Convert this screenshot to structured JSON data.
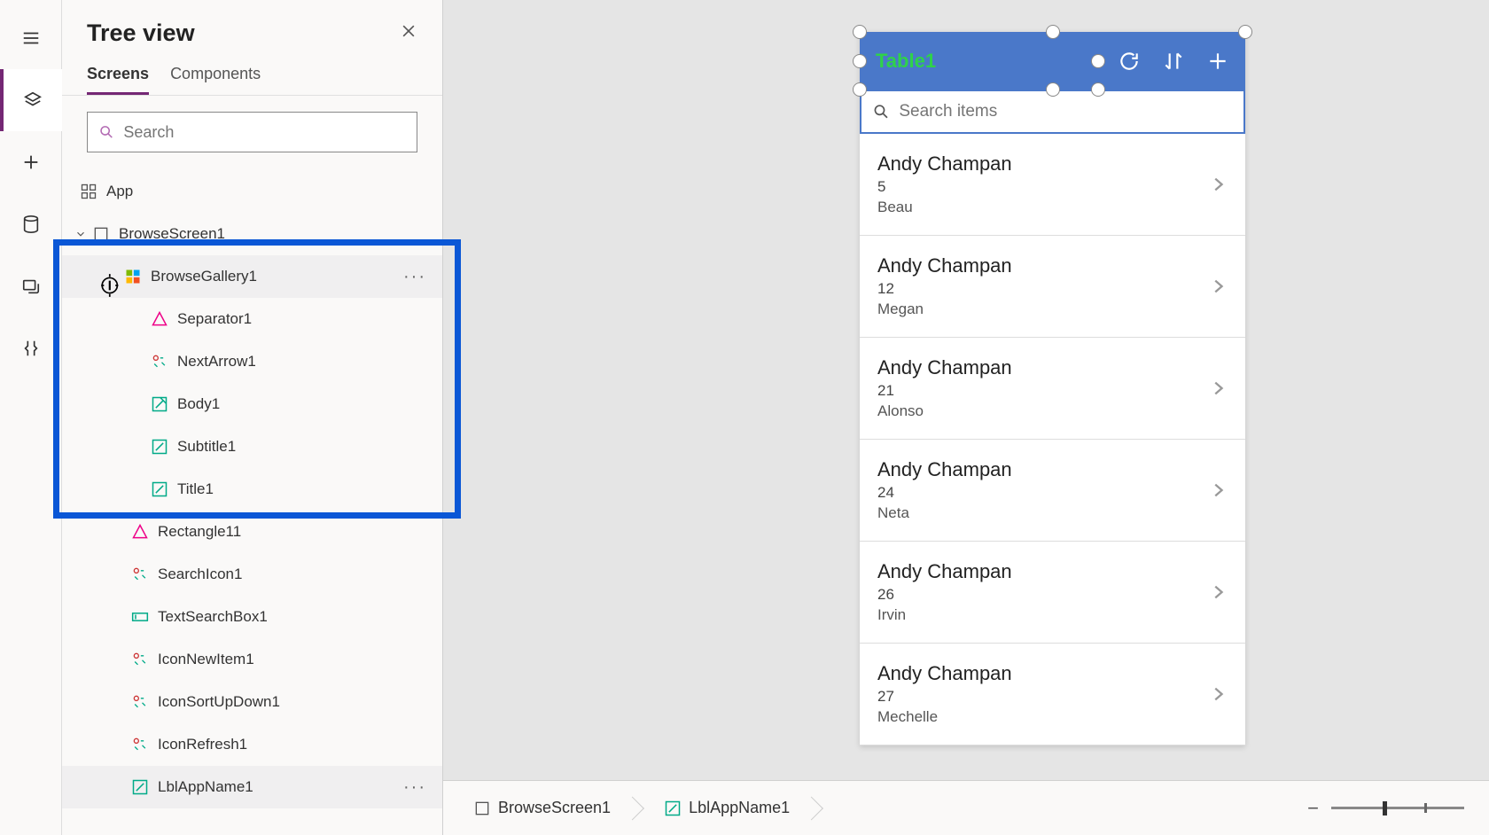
{
  "panel": {
    "title": "Tree view",
    "tabs": {
      "screens": "Screens",
      "components": "Components"
    },
    "search_placeholder": "Search"
  },
  "tree": {
    "app": "App",
    "browseScreen": "BrowseScreen1",
    "browseGallery": "BrowseGallery1",
    "children": {
      "separator": "Separator1",
      "nextArrow": "NextArrow1",
      "body": "Body1",
      "subtitle": "Subtitle1",
      "title": "Title1"
    },
    "rectangle": "Rectangle11",
    "searchIcon": "SearchIcon1",
    "textSearchBox": "TextSearchBox1",
    "iconNewItem": "IconNewItem1",
    "iconSortUpDown": "IconSortUpDown1",
    "iconRefresh": "IconRefresh1",
    "lblAppName": "LblAppName1"
  },
  "canvas": {
    "header_label": "Table1",
    "search_placeholder": "Search items",
    "rows": [
      {
        "title": "Andy Champan",
        "sub": "5",
        "body": "Beau"
      },
      {
        "title": "Andy Champan",
        "sub": "12",
        "body": "Megan"
      },
      {
        "title": "Andy Champan",
        "sub": "21",
        "body": "Alonso"
      },
      {
        "title": "Andy Champan",
        "sub": "24",
        "body": "Neta"
      },
      {
        "title": "Andy Champan",
        "sub": "26",
        "body": "Irvin"
      },
      {
        "title": "Andy Champan",
        "sub": "27",
        "body": "Mechelle"
      }
    ]
  },
  "breadcrumb": {
    "screen": "BrowseScreen1",
    "label": "LblAppName1"
  },
  "colors": {
    "accent": "#742774",
    "header": "#4a78c9",
    "highlight": "#0a57d6"
  }
}
